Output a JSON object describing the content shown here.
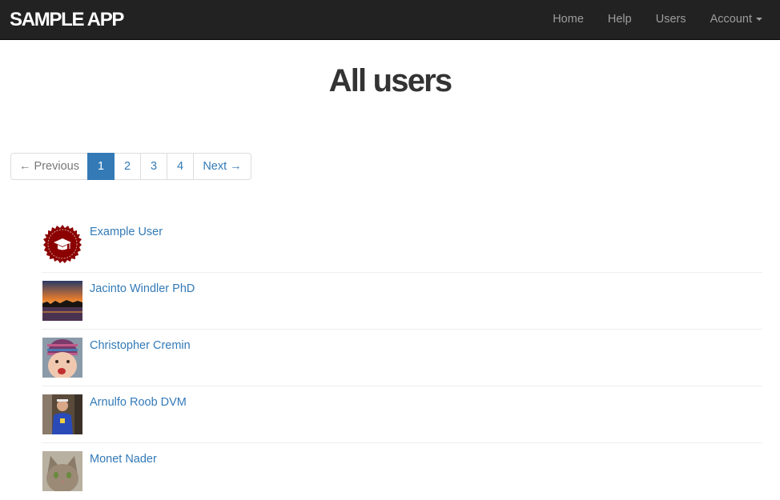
{
  "header": {
    "brand": "SAMPLE APP",
    "nav": [
      {
        "label": "Home"
      },
      {
        "label": "Help"
      },
      {
        "label": "Users"
      },
      {
        "label": "Account"
      }
    ]
  },
  "page": {
    "title": "All users"
  },
  "pagination": {
    "previous": "← Previous",
    "pages": [
      "1",
      "2",
      "3",
      "4"
    ],
    "current": "1",
    "next": "Next →"
  },
  "users": [
    {
      "name": "Example User",
      "avatar": "graduation-cap-badge"
    },
    {
      "name": "Jacinto Windler PhD",
      "avatar": "sunset-photo"
    },
    {
      "name": "Christopher Cremin",
      "avatar": "baby-knit-hat-photo"
    },
    {
      "name": "Arnulfo Roob DVM",
      "avatar": "person-blue-shirt-photo"
    },
    {
      "name": "Monet Nader",
      "avatar": "cat-photo"
    }
  ],
  "colors": {
    "navbar": "#222222",
    "link": "#337ab7",
    "active_page": "#337ab7",
    "badge": "#8b0000"
  }
}
